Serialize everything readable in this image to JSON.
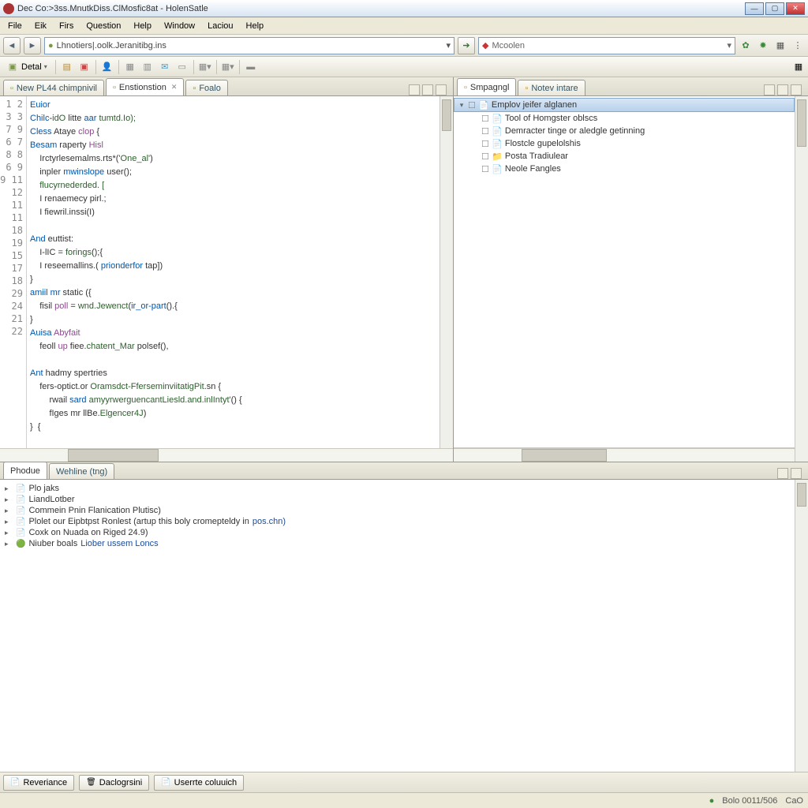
{
  "window": {
    "title": "Dec Co:>3ss.MnutkDiss.ClMosfic8at - HolenSatle"
  },
  "menubar": [
    "File",
    "Eik",
    "Firs",
    "Question",
    "Help",
    "Window",
    "Laciou",
    "Help"
  ],
  "address": {
    "value": "Lhnotiers|.oolk.Jeranitibg.ins",
    "search_placeholder": "Mcoolen"
  },
  "toolbar2": {
    "label": "Detal"
  },
  "editor": {
    "tabs": [
      {
        "label": "New PL44 chimpnivil",
        "active": false
      },
      {
        "label": "Enstionstion",
        "active": true,
        "closable": true
      },
      {
        "label": "Foalo",
        "active": false
      }
    ],
    "lines": [
      {
        "n": "1",
        "frags": [
          {
            "t": "Euior",
            "c": "kw"
          }
        ]
      },
      {
        "n": "2",
        "frags": [
          {
            "t": "Chilc",
            "c": "kw"
          },
          {
            "t": "-",
            "c": ""
          },
          {
            "t": "idO",
            "c": "fn"
          },
          {
            "t": " litte ",
            "c": ""
          },
          {
            "t": "aar",
            "c": "kw"
          },
          {
            "t": " tumtd.Io);",
            "c": "fn"
          }
        ]
      },
      {
        "n": "3",
        "frags": [
          {
            "t": "Cless",
            "c": "kw"
          },
          {
            "t": " Ataye ",
            "c": ""
          },
          {
            "t": "clop",
            "c": "str"
          },
          {
            "t": " {",
            "c": ""
          }
        ]
      },
      {
        "n": "3",
        "frags": [
          {
            "t": "Besam",
            "c": "kw"
          },
          {
            "t": " raperty ",
            "c": ""
          },
          {
            "t": "Hisl",
            "c": "str"
          }
        ]
      },
      {
        "n": "7",
        "frags": [
          {
            "t": "    Irctyrlesemalms.rts*(",
            "c": ""
          },
          {
            "t": "'One_al'",
            "c": "fn"
          },
          {
            "t": ")",
            "c": ""
          }
        ]
      },
      {
        "n": "9",
        "frags": [
          {
            "t": "    inpler ",
            "c": ""
          },
          {
            "t": "mwinslope",
            "c": "kw"
          },
          {
            "t": " user();",
            "c": ""
          }
        ]
      },
      {
        "n": "6",
        "frags": [
          {
            "t": "    flucyrnederded. [",
            "c": "fn"
          }
        ]
      },
      {
        "n": "7",
        "frags": [
          {
            "t": "    I renaemecy pirl.;",
            "c": ""
          }
        ]
      },
      {
        "n": "8",
        "frags": [
          {
            "t": "    I fiewril.inssi(I)",
            "c": ""
          }
        ]
      },
      {
        "n": "8",
        "frags": [
          {
            "t": "",
            "c": ""
          }
        ]
      },
      {
        "n": "6",
        "frags": [
          {
            "t": "And",
            "c": "kw"
          },
          {
            "t": " euttist:",
            "c": ""
          }
        ]
      },
      {
        "n": "9",
        "frags": [
          {
            "t": "    I-lIC = ",
            "c": ""
          },
          {
            "t": "forings",
            "c": "fn"
          },
          {
            "t": "();{",
            "c": ""
          }
        ]
      },
      {
        "n": "9",
        "frags": [
          {
            "t": "    I reseemallins.( ",
            "c": ""
          },
          {
            "t": "prionderfor",
            "c": "kw"
          },
          {
            "t": " tap])",
            "c": ""
          }
        ]
      },
      {
        "n": "11",
        "frags": [
          {
            "t": "}",
            "c": ""
          }
        ]
      },
      {
        "n": "12",
        "frags": [
          {
            "t": "amiil mr",
            "c": "kw"
          },
          {
            "t": " static ({",
            "c": ""
          }
        ]
      },
      {
        "n": "11",
        "frags": [
          {
            "t": "    fisil ",
            "c": ""
          },
          {
            "t": "poll",
            "c": "str"
          },
          {
            "t": " = ",
            "c": ""
          },
          {
            "t": "wnd.Jewenct",
            "c": "fn"
          },
          {
            "t": "(",
            "c": ""
          },
          {
            "t": "ir_or-part",
            "c": "kw"
          },
          {
            "t": "().{",
            "c": ""
          }
        ]
      },
      {
        "n": "11",
        "frags": [
          {
            "t": "}",
            "c": ""
          }
        ]
      },
      {
        "n": "18",
        "frags": [
          {
            "t": "Auisa",
            "c": "kw"
          },
          {
            "t": " Abyfait",
            "c": "str"
          }
        ]
      },
      {
        "n": "19",
        "frags": [
          {
            "t": "    feoll ",
            "c": ""
          },
          {
            "t": "up",
            "c": "str"
          },
          {
            "t": " fiee.",
            "c": ""
          },
          {
            "t": "chatent_Mar",
            "c": "fn"
          },
          {
            "t": " polsef(),",
            "c": ""
          }
        ]
      },
      {
        "n": "15",
        "frags": [
          {
            "t": "",
            "c": ""
          }
        ]
      },
      {
        "n": "17",
        "frags": [
          {
            "t": "Ant",
            "c": "kw"
          },
          {
            "t": " hadmy spertries",
            "c": ""
          }
        ]
      },
      {
        "n": "18",
        "frags": [
          {
            "t": "    fers-optict.or ",
            "c": ""
          },
          {
            "t": "Oramsdct-FferseminviitatigPit",
            "c": "fn"
          },
          {
            "t": ".sn {",
            "c": ""
          }
        ]
      },
      {
        "n": "29",
        "frags": [
          {
            "t": "        rwail ",
            "c": ""
          },
          {
            "t": "sard",
            "c": "kw"
          },
          {
            "t": " amyyrwerguencantLiesld.and.inlIntyt'",
            "c": "fn"
          },
          {
            "t": "() {",
            "c": ""
          }
        ]
      },
      {
        "n": "24",
        "frags": [
          {
            "t": "        fIges mr llBe.",
            "c": ""
          },
          {
            "t": "Elgencer4J",
            "c": "fn"
          },
          {
            "t": ")",
            "c": ""
          }
        ]
      },
      {
        "n": "21",
        "frags": [
          {
            "t": "}  {",
            "c": ""
          }
        ]
      },
      {
        "n": "22",
        "frags": [
          {
            "t": "",
            "c": ""
          }
        ]
      }
    ]
  },
  "sidepane": {
    "tabs": [
      {
        "label": "Smpagngl",
        "active": true
      },
      {
        "label": "Notev intare",
        "active": false
      }
    ],
    "tree": [
      {
        "depth": 0,
        "exp": "▾",
        "icon": "📄",
        "label": "Emplov jeifer alglanen",
        "sel": true
      },
      {
        "depth": 1,
        "exp": "",
        "icon": "📄",
        "label": "Tool of Homgster oblscs",
        "sel": false
      },
      {
        "depth": 1,
        "exp": "",
        "icon": "📄",
        "label": "Demracter tinge or aledgle getinning",
        "sel": false
      },
      {
        "depth": 1,
        "exp": "",
        "icon": "📄",
        "label": "Flostcle gupelolshis",
        "sel": false
      },
      {
        "depth": 1,
        "exp": "",
        "icon": "📁",
        "label": "Posta Tradiulear",
        "sel": false
      },
      {
        "depth": 1,
        "exp": "",
        "icon": "📄",
        "label": "Neole Fangles",
        "sel": false
      }
    ]
  },
  "bottom_tabs": [
    {
      "label": "Phodue",
      "active": true
    },
    {
      "label": "Wehline (tng)",
      "active": false
    }
  ],
  "console": [
    {
      "icon": "📄",
      "text": "Plo jaks",
      "link": ""
    },
    {
      "icon": "📄",
      "text": "LiandLotber",
      "link": ""
    },
    {
      "icon": "📄",
      "text": "Commein Pnin Flanication Plutisc)",
      "link": ""
    },
    {
      "icon": "📄",
      "text": "Plolet our Eipbtpst Ronlest (artup this boly cromepteldy in ",
      "link": "pos.chn)"
    },
    {
      "icon": "📄",
      "text": "Coxk on Nuada on Riged 24.9)",
      "link": ""
    },
    {
      "icon": "🟢",
      "text": "Niuber boals ",
      "link": "Liober ussem Loncs"
    }
  ],
  "bottom_buttons": [
    {
      "icon": "📄",
      "label": "Reveriance"
    },
    {
      "icon": "🗑",
      "label": "Daclogrsini"
    },
    {
      "icon": "📄",
      "label": "Userrte coluuich"
    }
  ],
  "status": {
    "left": "",
    "right1": "Bolo 0011/506",
    "right2": "CaO"
  }
}
